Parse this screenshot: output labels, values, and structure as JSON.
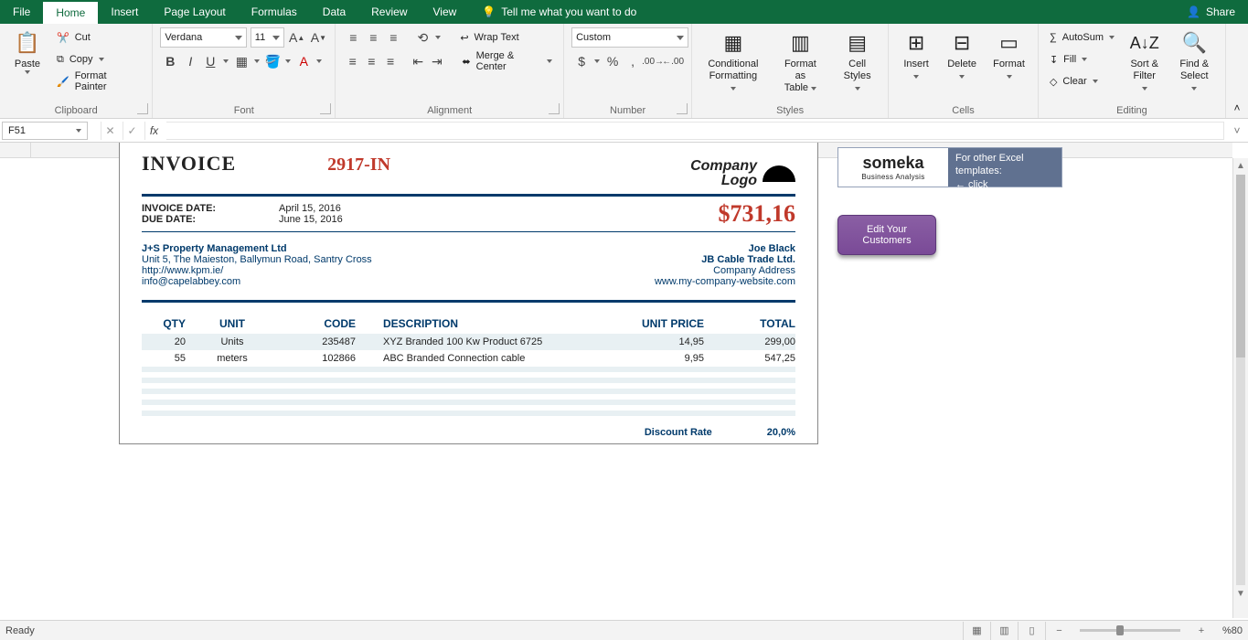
{
  "tabs": {
    "file": "File",
    "home": "Home",
    "insert": "Insert",
    "page_layout": "Page Layout",
    "formulas": "Formulas",
    "data": "Data",
    "review": "Review",
    "view": "View",
    "tell_me": "Tell me what you want to do",
    "share": "Share"
  },
  "ribbon": {
    "clipboard": {
      "paste": "Paste",
      "cut": "Cut",
      "copy": "Copy",
      "fp": "Format Painter",
      "label": "Clipboard"
    },
    "font": {
      "name": "Verdana",
      "size": "11",
      "label": "Font"
    },
    "alignment": {
      "wrap": "Wrap Text",
      "merge": "Merge & Center",
      "label": "Alignment"
    },
    "number": {
      "format": "Custom",
      "label": "Number"
    },
    "styles": {
      "cond": "Conditional",
      "cond2": "Formatting",
      "fat": "Format as",
      "fat2": "Table",
      "cs": "Cell",
      "cs2": "Styles",
      "label": "Styles"
    },
    "cells": {
      "insert": "Insert",
      "delete": "Delete",
      "format": "Format",
      "label": "Cells"
    },
    "editing": {
      "autosum": "AutoSum",
      "fill": "Fill",
      "clear": "Clear",
      "sort": "Sort &",
      "sort2": "Filter",
      "find": "Find &",
      "find2": "Select",
      "label": "Editing"
    }
  },
  "namebox": "F51",
  "invoice": {
    "title": "INVOICE",
    "number": "2917-IN",
    "logo_text": "Company\nLogo",
    "date_lbl": "INVOICE DATE:",
    "date": "April 15, 2016",
    "due_lbl": "DUE DATE:",
    "due": "June 15, 2016",
    "total": "$731,16",
    "from": {
      "name": "J+S Property Management Ltd",
      "addr": "Unit 5, The Maieston, Ballymun Road, Santry Cross",
      "url": "http://www.kpm.ie/",
      "email": "info@capelabbey.com"
    },
    "to": {
      "name": "Joe Black",
      "company": "JB Cable Trade Ltd.",
      "addr": "Company Address",
      "url": "www.my-company-website.com"
    },
    "cols": {
      "qty": "QTY",
      "unit": "UNIT",
      "code": "CODE",
      "desc": "DESCRIPTION",
      "up": "UNIT PRICE",
      "tot": "TOTAL"
    },
    "rows": [
      {
        "qty": "20",
        "unit": "Units",
        "code": "235487",
        "desc": "XYZ Branded 100 Kw Product 6725",
        "up": "14,95",
        "tot": "299,00"
      },
      {
        "qty": "55",
        "unit": "meters",
        "code": "102866",
        "desc": "ABC Branded Connection cable",
        "up": "9,95",
        "tot": "547,25"
      }
    ],
    "discount_lbl": "Discount Rate",
    "discount": "20,0%"
  },
  "someka": {
    "brand": "someka",
    "sub": "Business Analysis",
    "txt1": "For other Excel",
    "txt2": "templates:",
    "txt3": "← click"
  },
  "edit_btn": "Edit Your\nCustomers",
  "status": {
    "ready": "Ready",
    "zoom": "%80"
  }
}
